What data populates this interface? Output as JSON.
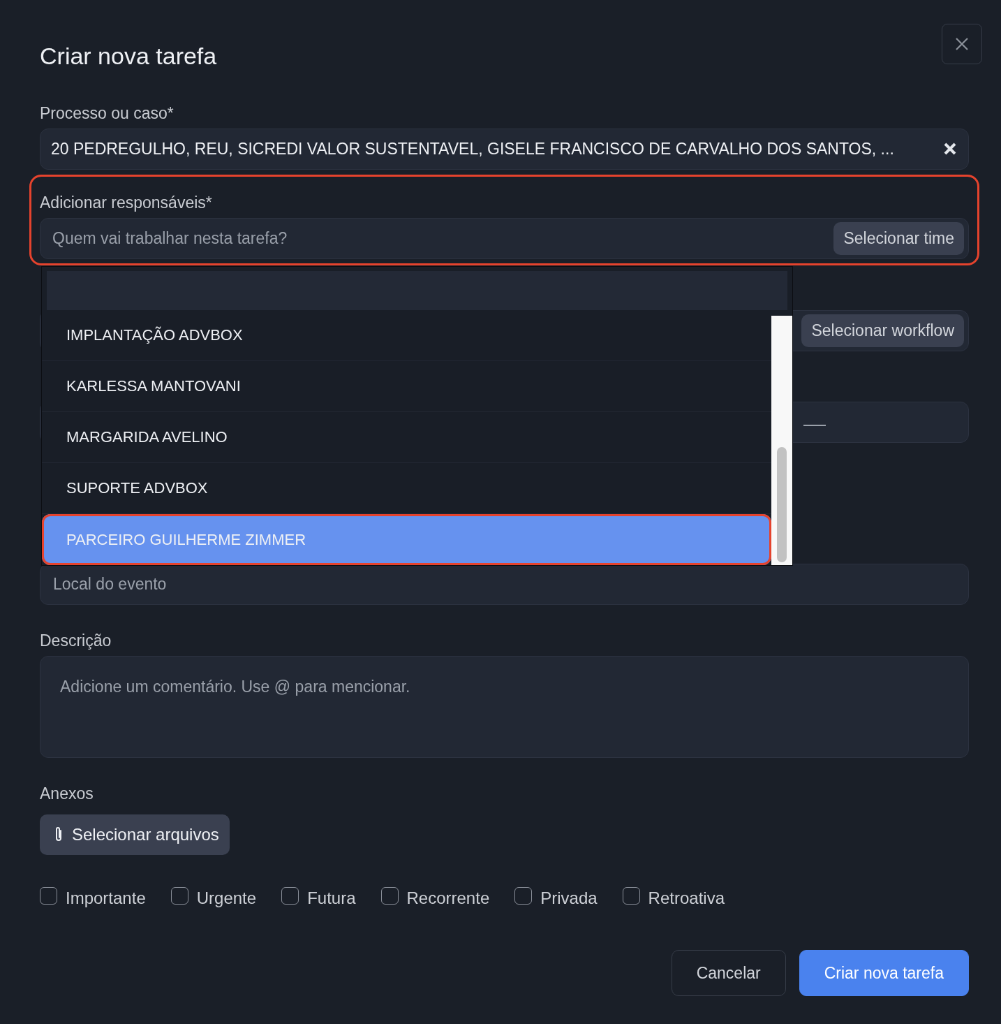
{
  "dialog": {
    "title": "Criar nova tarefa"
  },
  "case_field": {
    "label": "Processo ou caso*",
    "value": "20 PEDREGULHO, REU, SICREDI VALOR SUSTENTAVEL, GISELE FRANCISCO DE CARVALHO DOS SANTOS, ..."
  },
  "responsibles": {
    "label": "Adicionar responsáveis*",
    "placeholder": "Quem vai trabalhar nesta tarefa?",
    "team_button": "Selecionar time",
    "highlighted": true
  },
  "dropdown": {
    "options": [
      {
        "label": "IMPLANTAÇÃO ADVBOX",
        "selected": false,
        "highlighted": false
      },
      {
        "label": "KARLESSA MANTOVANI",
        "selected": false,
        "highlighted": false
      },
      {
        "label": "MARGARIDA AVELINO",
        "selected": false,
        "highlighted": false
      },
      {
        "label": "SUPORTE ADVBOX",
        "selected": false,
        "highlighted": false
      },
      {
        "label": "PARCEIRO GUILHERME ZIMMER",
        "selected": true,
        "highlighted": true
      }
    ]
  },
  "workflow_button": "Selecionar workflow",
  "location_field": {
    "placeholder": "Local do evento"
  },
  "description": {
    "label": "Descrição",
    "placeholder": "Adicione um comentário. Use @ para mencionar."
  },
  "attachments": {
    "label": "Anexos",
    "button": "Selecionar arquivos"
  },
  "flags": [
    {
      "label": "Importante",
      "checked": false
    },
    {
      "label": "Urgente",
      "checked": false
    },
    {
      "label": "Futura",
      "checked": false
    },
    {
      "label": "Recorrente",
      "checked": false
    },
    {
      "label": "Privada",
      "checked": false
    },
    {
      "label": "Retroativa",
      "checked": false
    }
  ],
  "buttons": [
    {
      "label": "Cancelar",
      "kind": "secondary"
    },
    {
      "label": "Criar nova tarefa",
      "kind": "primary"
    }
  ]
}
